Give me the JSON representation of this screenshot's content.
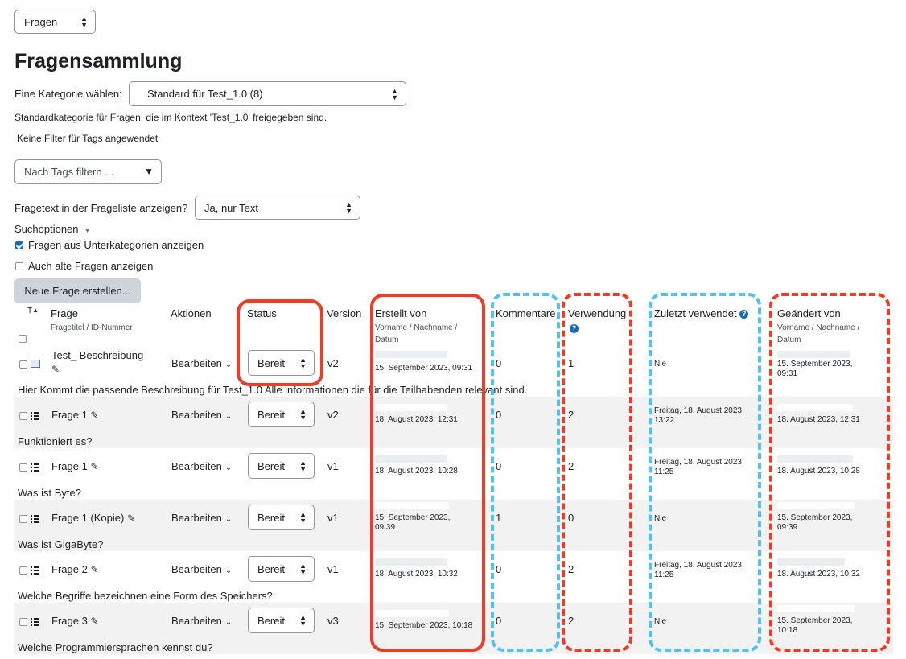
{
  "top_select": {
    "value": "Fragen"
  },
  "page_title": "Fragensammlung",
  "category": {
    "label": "Eine Kategorie wählen:",
    "value": "Standard für Test_1.0 (8)",
    "description": "Standardkategorie für Fragen, die im Kontext 'Test_1.0' freigegeben sind."
  },
  "tags": {
    "no_filter_text": "Keine Filter für Tags angewendet",
    "placeholder": "Nach Tags filtern ..."
  },
  "fragetext": {
    "label": "Fragetext in der Frageliste anzeigen?",
    "value": "Ja, nur Text"
  },
  "suchoptionen": {
    "label": "Suchoptionen",
    "opt1": "Fragen aus Unterkategorien anzeigen",
    "opt2": "Auch alte Fragen anzeigen"
  },
  "new_question_button": "Neue Frage erstellen...",
  "table": {
    "headers": {
      "t": "T",
      "frage": "Frage",
      "frage_sub": "Fragetitel / ID-Nummer",
      "aktionen": "Aktionen",
      "status": "Status",
      "version": "Version",
      "erstellt": "Erstellt von",
      "erstellt_sub1": "Vorname / Nachname /",
      "erstellt_sub2": "Datum",
      "kommentare": "Kommentare",
      "verwendung": "Verwendung",
      "zuletzt": "Zuletzt verwendet",
      "geaendert": "Geändert von",
      "geaendert_sub1": "Vorname / Nachname /",
      "geaendert_sub2": "Datum"
    },
    "rows": [
      {
        "name": "Test_ Beschreibung",
        "action": "Bearbeiten",
        "status": "Bereit",
        "version": "v2",
        "created": "15. September 2023, 09:31",
        "comments": "0",
        "usage": "1",
        "last_used": "Nie",
        "modified1": "15. September 2023,",
        "modified2": "09:31",
        "text": "Hier Kommt die passende Beschreibung für Test_1.0 Alle informationen die für die Teilhabenden relevant sind."
      },
      {
        "name": "Frage 1",
        "action": "Bearbeiten",
        "status": "Bereit",
        "version": "v2",
        "created": "18. August 2023, 12:31",
        "comments": "0",
        "usage": "2",
        "last_used1": "Freitag, 18. August 2023,",
        "last_used2": "13:22",
        "modified": "18. August 2023, 12:31",
        "text": "Funktioniert es?"
      },
      {
        "name": "Frage 1",
        "action": "Bearbeiten",
        "status": "Bereit",
        "version": "v1",
        "created": "18. August 2023, 10:28",
        "comments": "0",
        "usage": "2",
        "last_used1": "Freitag, 18. August 2023,",
        "last_used2": "11:25",
        "modified": "18. August 2023, 10:28",
        "text": "Was ist Byte?"
      },
      {
        "name": "Frage 1 (Kopie)",
        "action": "Bearbeiten",
        "status": "Bereit",
        "version": "v1",
        "created1": "15. September 2023,",
        "created2": "09:39",
        "comments": "1",
        "usage": "0",
        "last_used": "Nie",
        "modified1": "15. September 2023,",
        "modified2": "09:39",
        "text": "Was ist GigaByte?"
      },
      {
        "name": "Frage 2",
        "action": "Bearbeiten",
        "status": "Bereit",
        "version": "v1",
        "created": "18. August 2023, 10:32",
        "comments": "0",
        "usage": "2",
        "last_used1": "Freitag, 18. August 2023,",
        "last_used2": "11:25",
        "modified": "18. August 2023, 10:32",
        "text": "Welche Begriffe bezeichnen eine Form des Speichers?"
      },
      {
        "name": "Frage 3",
        "action": "Bearbeiten",
        "status": "Bereit",
        "version": "v3",
        "created": "15. September 2023, 10:18",
        "comments": "0",
        "usage": "2",
        "last_used": "Nie",
        "modified1": "15. September 2023,",
        "modified2": "10:18",
        "text": "Welche Programmiersprachen kennst du?"
      }
    ]
  }
}
